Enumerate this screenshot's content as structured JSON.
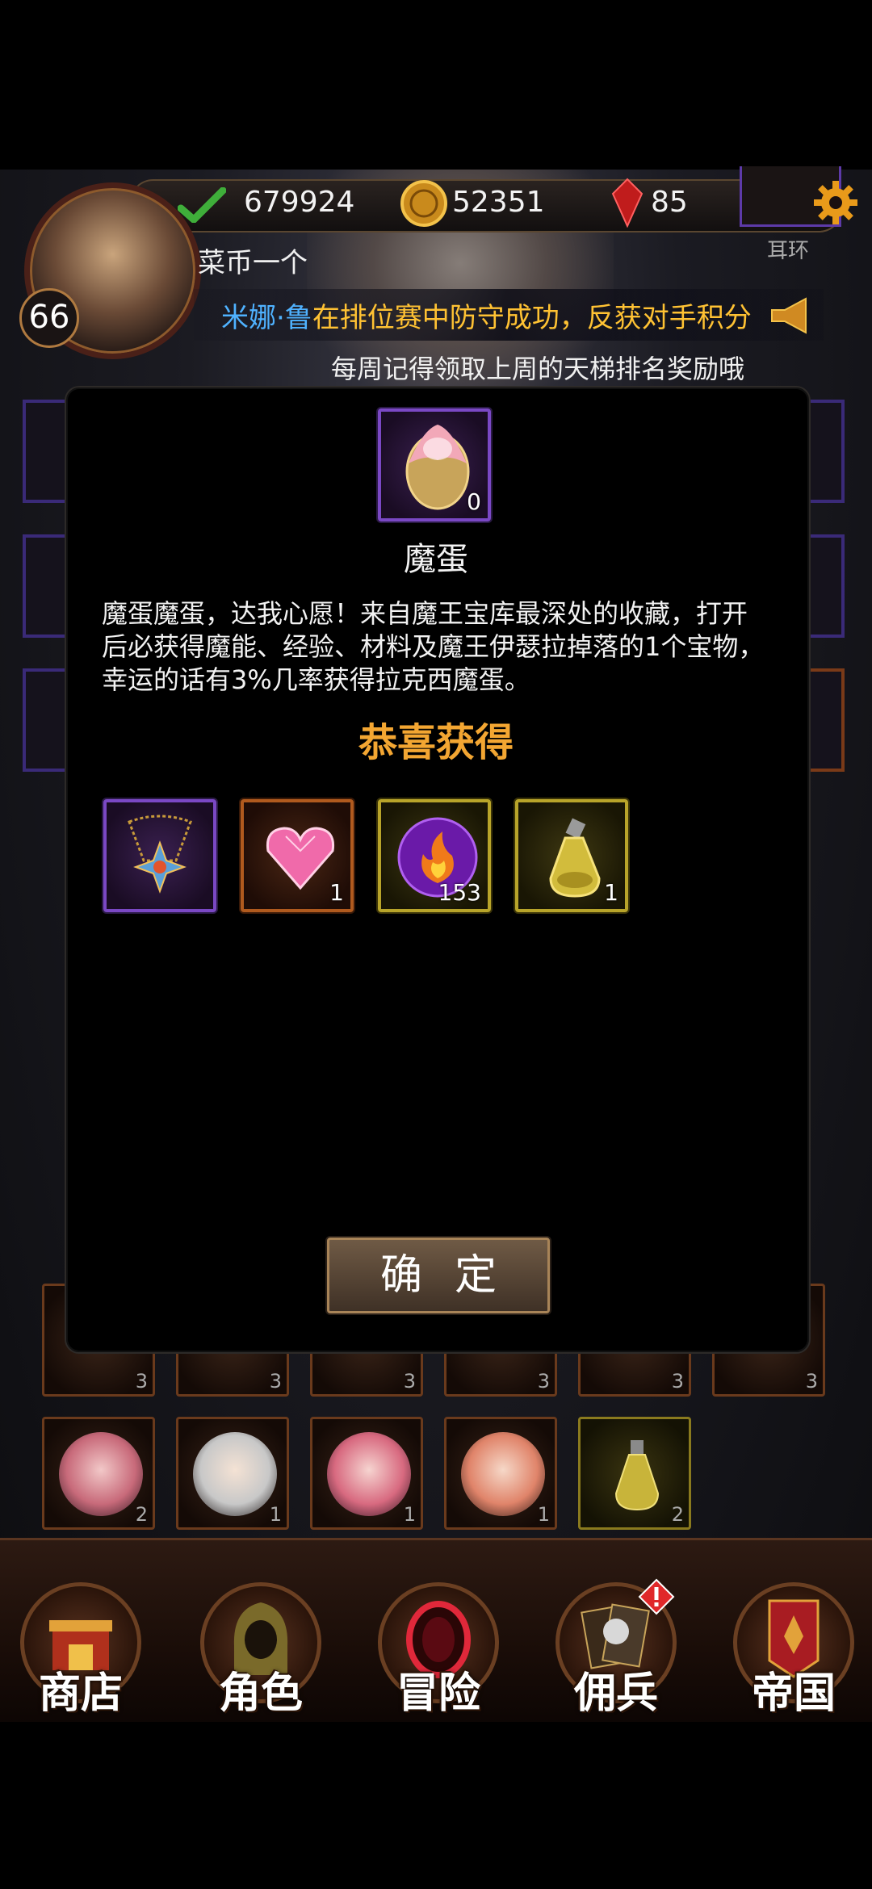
{
  "header": {
    "level": "66",
    "player_name": "菜币一个",
    "resources": {
      "stamina": "679924",
      "gold": "52351",
      "gems": "85"
    },
    "notice": {
      "name": "米娜·鲁",
      "message": "在排位赛中防守成功，反获对手积分"
    },
    "ticker": "每周记得领取上周的天梯排名奖励哦",
    "earring_label": "耳环"
  },
  "modal": {
    "item": {
      "icon": "magic-egg-icon",
      "count": "0",
      "name": "魔蛋",
      "description": "魔蛋魔蛋，达我心愿！来自魔王宝库最深处的收藏，打开后必获得魔能、经验、材料及魔王伊瑟拉掉落的1个宝物，幸运的话有3%几率获得拉克西魔蛋。"
    },
    "congrats": "恭喜获得",
    "rewards": [
      {
        "icon": "necklace-icon",
        "rarity": "purple",
        "count": ""
      },
      {
        "icon": "heart-gem-icon",
        "rarity": "orange",
        "count": "1"
      },
      {
        "icon": "fire-orb-icon",
        "rarity": "yellow",
        "count": "153"
      },
      {
        "icon": "potion-flask-icon",
        "rarity": "yellow",
        "count": "1"
      }
    ],
    "confirm_label": "确定"
  },
  "inventory": {
    "row_partial_counts": [
      "3",
      "3",
      "3",
      "3",
      "3",
      "3"
    ],
    "row_counts": [
      "2",
      "1",
      "1",
      "1",
      "2"
    ]
  },
  "nav": {
    "items": [
      {
        "label": "商店",
        "icon": "shop-icon"
      },
      {
        "label": "角色",
        "icon": "hooded-character-icon"
      },
      {
        "label": "冒险",
        "icon": "portal-icon"
      },
      {
        "label": "佣兵",
        "icon": "mercenary-cards-icon"
      },
      {
        "label": "帝国",
        "icon": "empire-banner-icon"
      }
    ],
    "alert_icon": "exclamation-icon"
  },
  "colors": {
    "accent_orange": "#f3a632",
    "notice_name": "#4fb2ff",
    "notice_text": "#ffc233",
    "rarity_purple": "#7a48c4",
    "rarity_orange": "#b05a1e",
    "rarity_yellow": "#b8a42a"
  }
}
